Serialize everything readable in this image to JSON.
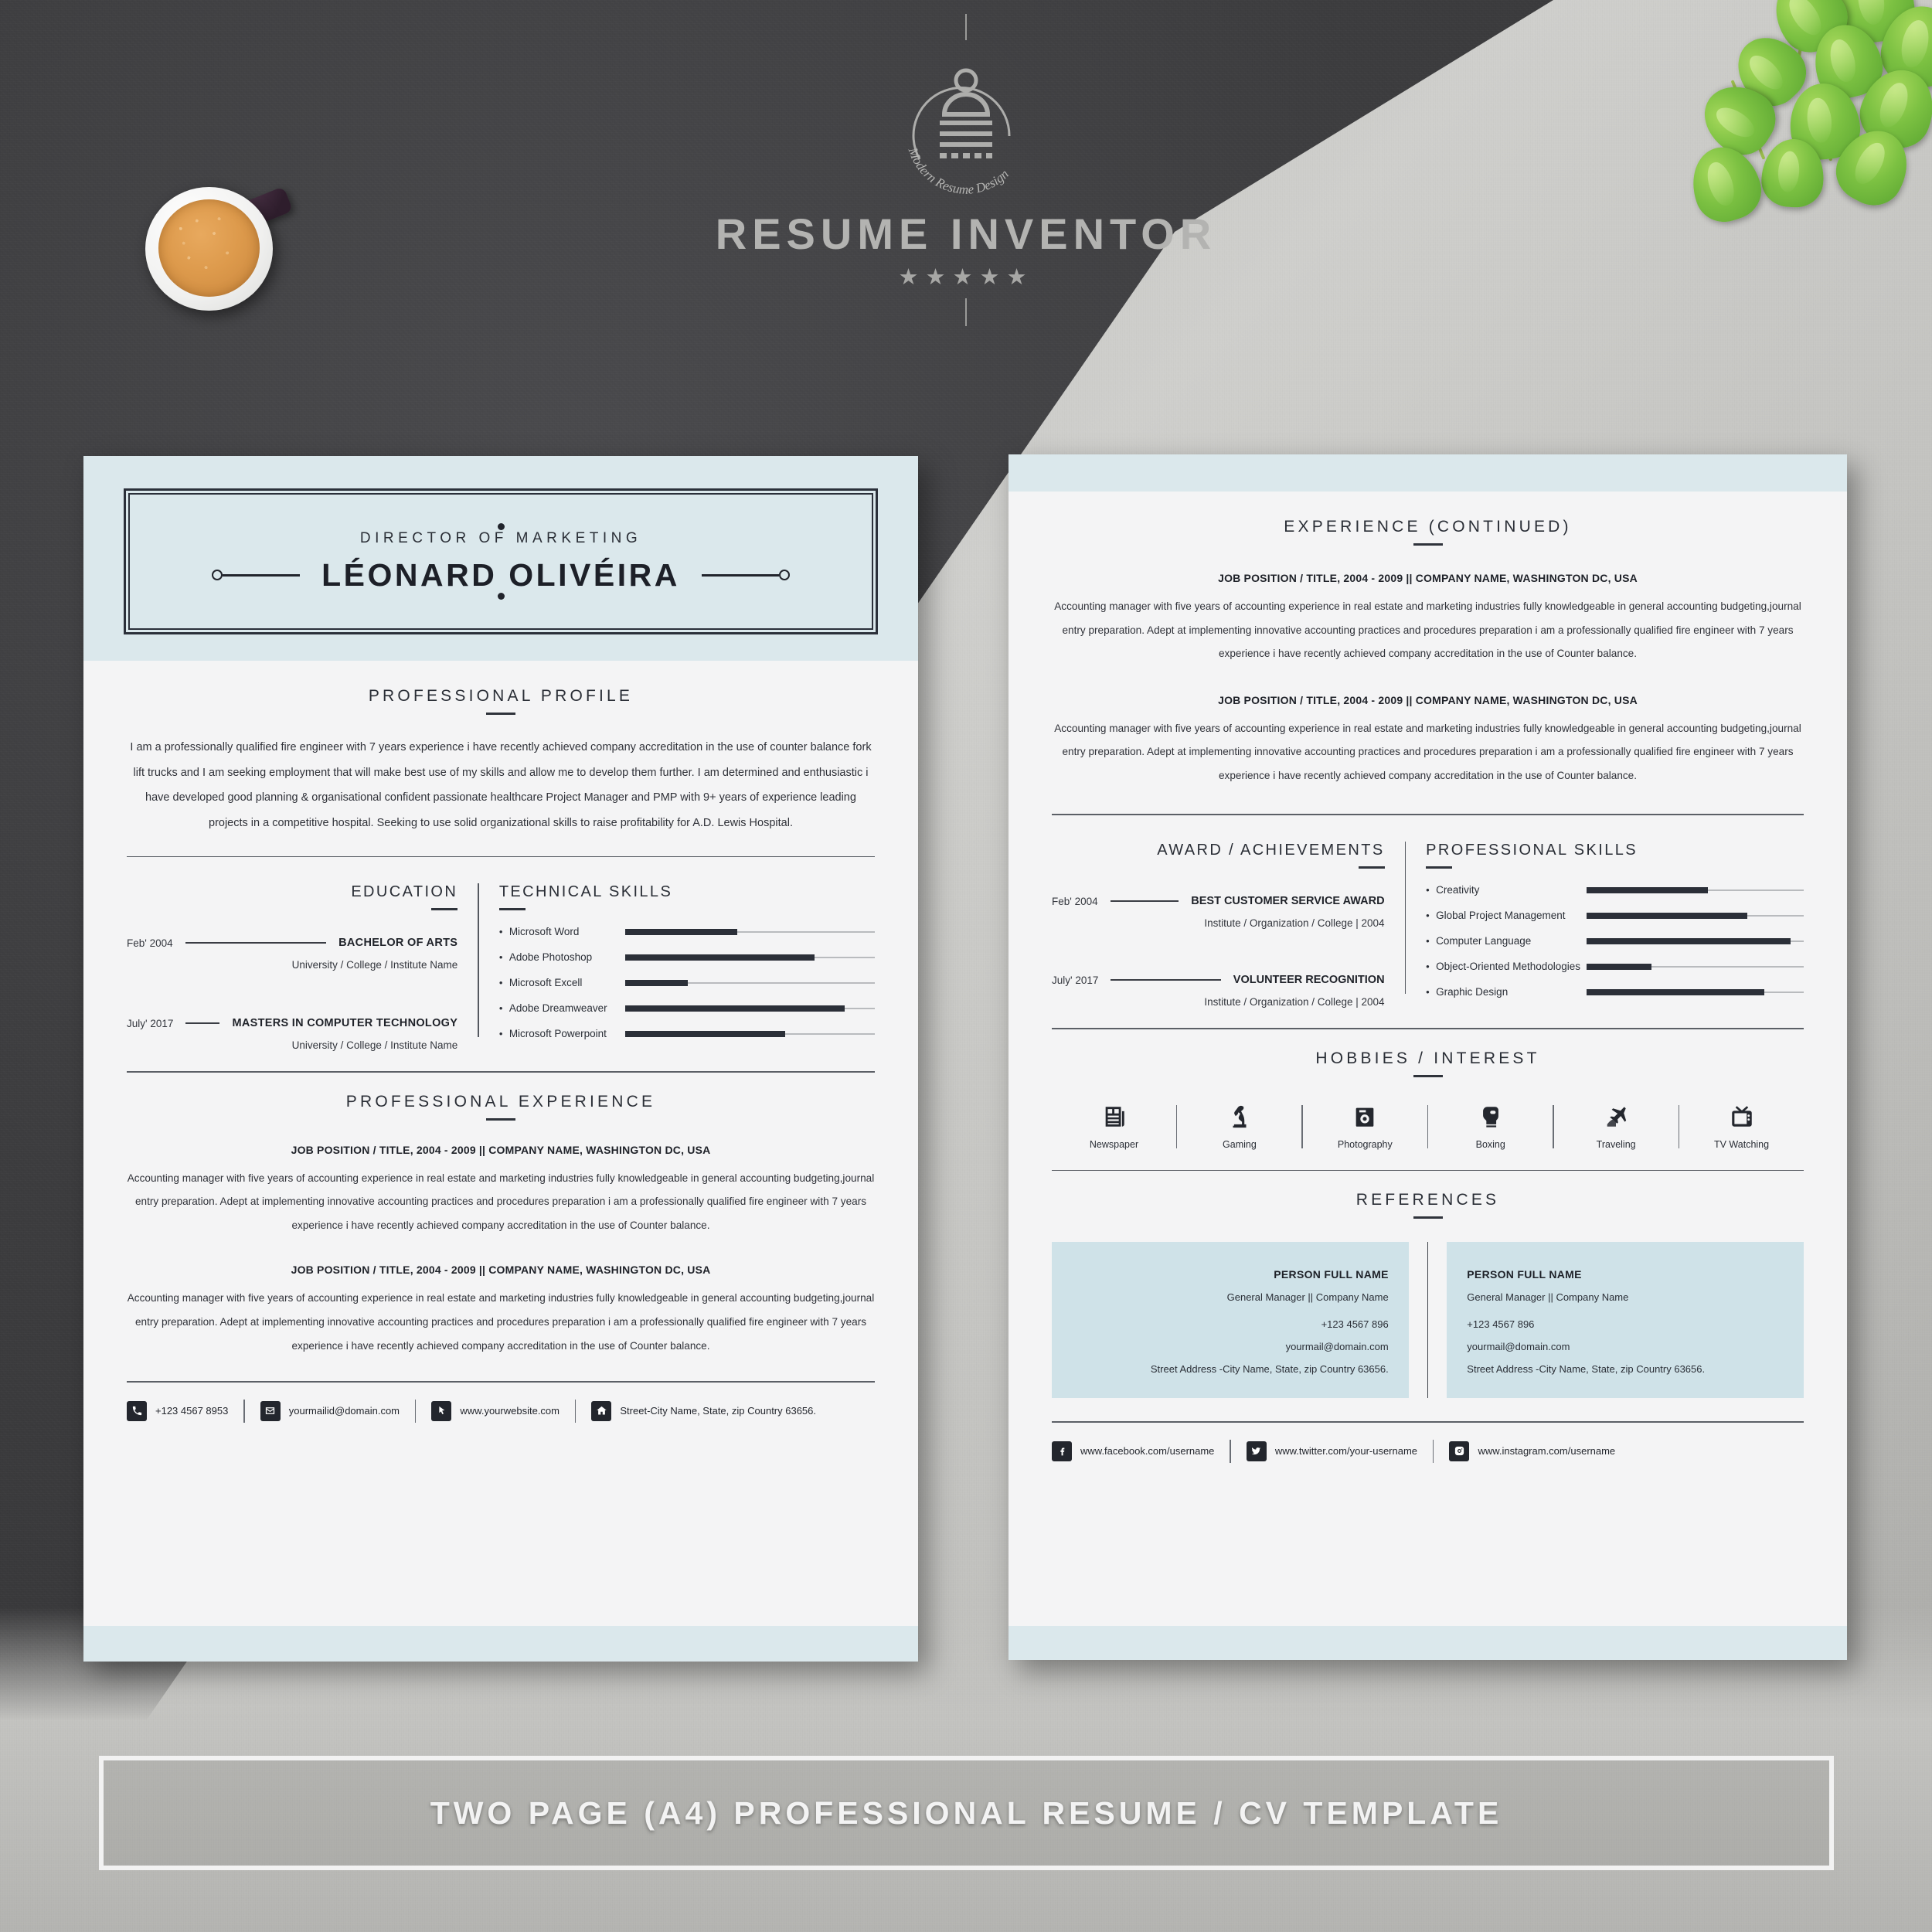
{
  "brand": {
    "logo_title": "RESUME INVENTOR",
    "logo_tagline": "Modern Resume Design",
    "stars": "★★★★★",
    "accent_blue": "#dbe8ec",
    "accent_dark": "#23262d"
  },
  "banner": {
    "text": "TWO PAGE (A4) PROFESSIONAL RESUME / CV TEMPLATE"
  },
  "page1": {
    "header": {
      "job_title": "DIRECTOR OF MARKETING",
      "name": "LÉONARD OLIVÉIRA"
    },
    "profile": {
      "title": "PROFESSIONAL PROFILE",
      "text": "I am a professionally qualified fire engineer with 7 years experience i have recently achieved company accreditation in the use of counter balance fork lift trucks and I am seeking employment that will make best use of my skills and allow me to develop them further. I am determined and enthusiastic i have developed good planning & organisational confident passionate healthcare Project Manager and PMP with 9+ years of experience leading projects in a competitive hospital. Seeking to use solid organizational skills to raise profitability for A.D. Lewis Hospital."
    },
    "education": {
      "title": "EDUCATION",
      "items": [
        {
          "date": "Feb' 2004",
          "degree": "BACHELOR OF ARTS",
          "school": "University / College / Institute Name"
        },
        {
          "date": "July' 2017",
          "degree": "MASTERS IN COMPUTER TECHNOLOGY",
          "school": "University / College / Institute Name"
        }
      ]
    },
    "technical_skills": {
      "title": "TECHNICAL SKILLS",
      "items": [
        {
          "name": "Microsoft Word",
          "level": 45
        },
        {
          "name": "Adobe Photoshop",
          "level": 76
        },
        {
          "name": "Microsoft Excell",
          "level": 25
        },
        {
          "name": "Adobe Dreamweaver",
          "level": 88
        },
        {
          "name": "Microsoft Powerpoint",
          "level": 64
        }
      ]
    },
    "experience": {
      "title": "PROFESSIONAL EXPERIENCE",
      "items": [
        {
          "heading": "JOB POSITION / TITLE, 2004 - 2009   ||   COMPANY NAME, WASHINGTON DC, USA",
          "body": "Accounting manager with five years of accounting experience in real estate and marketing industries fully knowledgeable in general accounting budgeting,journal entry preparation. Adept at implementing innovative accounting practices and procedures preparation i am a professionally qualified fire engineer with 7 years experience i have recently achieved company accreditation in the use of Counter balance."
        },
        {
          "heading": "JOB POSITION / TITLE, 2004 - 2009   ||   COMPANY NAME, WASHINGTON DC, USA",
          "body": "Accounting manager with five years of accounting experience in real estate and marketing industries fully knowledgeable in general accounting budgeting,journal entry preparation. Adept at implementing innovative accounting practices and procedures preparation i am a professionally qualified fire engineer with 7 years experience i have recently achieved company accreditation in the use of Counter balance."
        }
      ]
    },
    "contacts": [
      {
        "icon": "phone-icon",
        "text": "+123 4567 8953"
      },
      {
        "icon": "envelope-icon",
        "text": "yourmailid@domain.com"
      },
      {
        "icon": "cursor-icon",
        "text": "www.yourwebsite.com"
      },
      {
        "icon": "home-icon",
        "text": "Street-City Name, State, zip Country 63656."
      }
    ]
  },
  "page2": {
    "experience": {
      "title": "EXPERIENCE (CONTINUED)",
      "items": [
        {
          "heading": "JOB POSITION / TITLE, 2004 - 2009   ||   COMPANY NAME, WASHINGTON DC, USA",
          "body": "Accounting manager with five years of accounting experience in real estate and marketing industries fully knowledgeable in general accounting budgeting,journal entry preparation. Adept at implementing innovative accounting practices and procedures preparation i am a professionally qualified fire engineer with 7 years experience i have recently achieved company accreditation in the use of Counter balance."
        },
        {
          "heading": "JOB POSITION / TITLE, 2004 - 2009   ||   COMPANY NAME, WASHINGTON DC, USA",
          "body": "Accounting manager with five years of accounting experience in real estate and marketing industries fully knowledgeable in general accounting budgeting,journal entry preparation. Adept at implementing innovative accounting practices and procedures preparation i am a professionally qualified fire engineer with 7 years experience i have recently achieved company accreditation in the use of Counter balance."
        }
      ]
    },
    "awards": {
      "title": "AWARD / ACHIEVEMENTS",
      "items": [
        {
          "date": "Feb' 2004",
          "name": "BEST CUSTOMER SERVICE AWARD",
          "sub": "Institute / Organization / College | 2004"
        },
        {
          "date": "July' 2017",
          "name": "VOLUNTEER RECOGNITION",
          "sub": "Institute / Organization / College | 2004"
        }
      ]
    },
    "professional_skills": {
      "title": "PROFESSIONAL SKILLS",
      "items": [
        {
          "name": "Creativity",
          "level": 56
        },
        {
          "name": "Global Project Management",
          "level": 74
        },
        {
          "name": "Computer Language",
          "level": 94
        },
        {
          "name": "Object-Oriented Methodologies",
          "level": 30
        },
        {
          "name": "Graphic Design",
          "level": 82
        }
      ]
    },
    "hobbies": {
      "title": "HOBBIES / INTEREST",
      "items": [
        {
          "icon": "newspaper-icon",
          "label": "Newspaper"
        },
        {
          "icon": "chess-knight-icon",
          "label": "Gaming"
        },
        {
          "icon": "camera-icon",
          "label": "Photography"
        },
        {
          "icon": "boxing-glove-icon",
          "label": "Boxing"
        },
        {
          "icon": "airplane-icon",
          "label": "Traveling"
        },
        {
          "icon": "television-icon",
          "label": "TV Watching"
        }
      ]
    },
    "references": {
      "title": "REFERENCES",
      "items": [
        {
          "name": "PERSON FULL NAME",
          "role": "General Manager   ||   Company Name",
          "phone": "+123 4567 896",
          "email": "yourmail@domain.com",
          "address": "Street Address -City Name, State, zip Country 63656."
        },
        {
          "name": "PERSON FULL NAME",
          "role": "General Manager   ||   Company Name",
          "phone": "+123 4567 896",
          "email": "yourmail@domain.com",
          "address": "Street Address -City Name, State, zip Country 63656."
        }
      ]
    },
    "social": [
      {
        "icon": "facebook-icon",
        "text": "www.facebook.com/username"
      },
      {
        "icon": "twitter-icon",
        "text": "www.twitter.com/your-username"
      },
      {
        "icon": "instagram-icon",
        "text": "www.instagram.com/username"
      }
    ]
  }
}
